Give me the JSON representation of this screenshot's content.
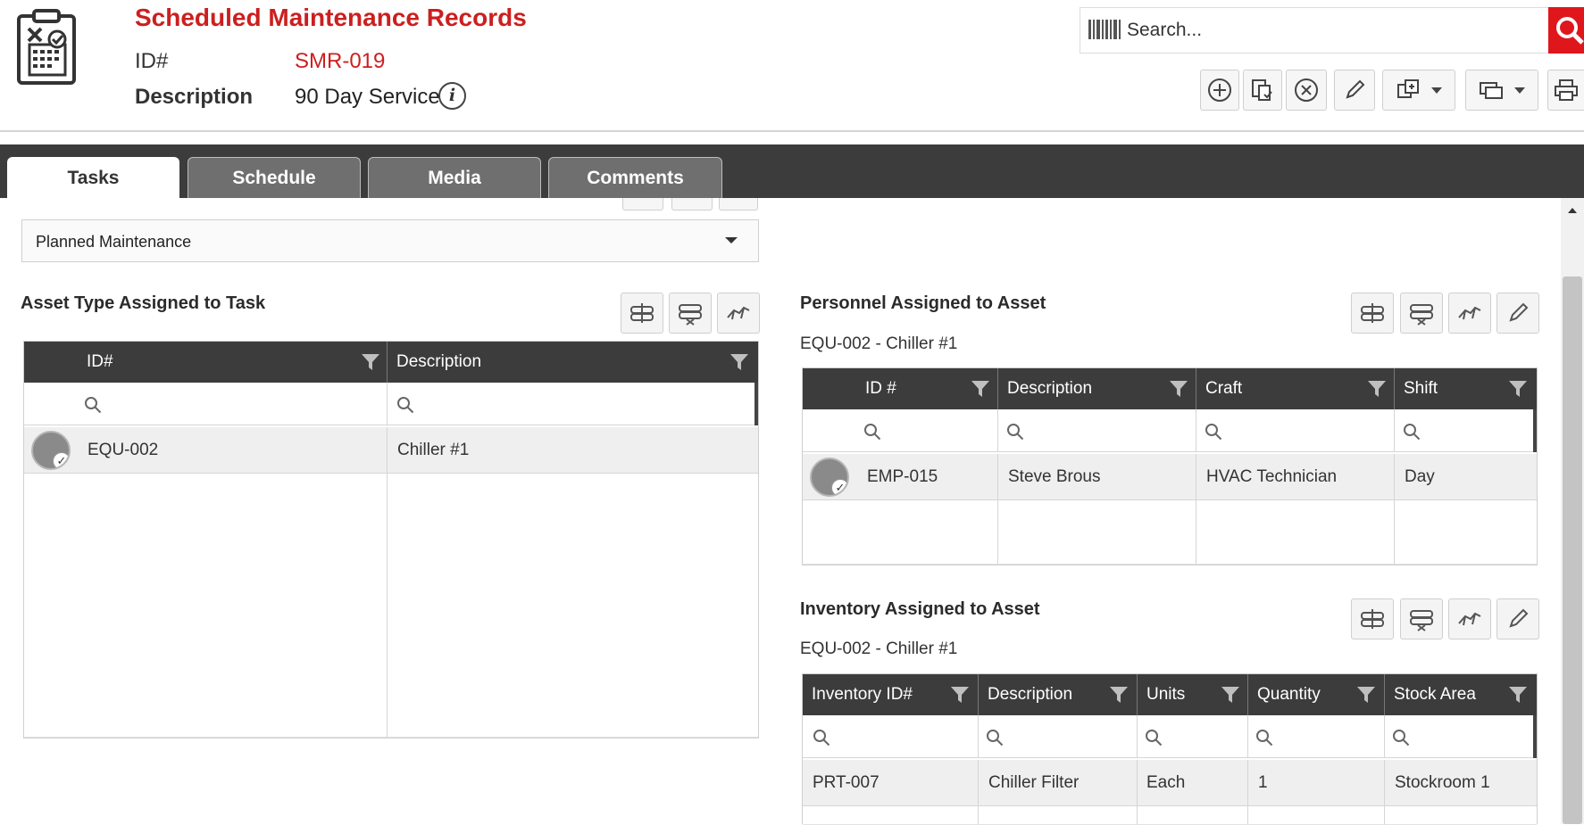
{
  "header": {
    "title": "Scheduled Maintenance Records",
    "id_label": "ID#",
    "id_value": "SMR-019",
    "description_label": "Description",
    "description_value": "90 Day Service",
    "info_glyph": "i"
  },
  "search": {
    "placeholder": "Search..."
  },
  "toolbar": {
    "buttons": [
      "add-icon",
      "copy-icon",
      "cancel-icon",
      "edit-icon",
      "clone-icon",
      "message-icon",
      "print-icon"
    ]
  },
  "tabs": [
    {
      "label": "Tasks",
      "active": true
    },
    {
      "label": "Schedule",
      "active": false
    },
    {
      "label": "Media",
      "active": false
    },
    {
      "label": "Comments",
      "active": false
    }
  ],
  "task_type": {
    "selected": "Planned Maintenance"
  },
  "asset_type": {
    "title": "Asset Type Assigned to Task",
    "columns": [
      "ID#",
      "Description"
    ],
    "rows": [
      {
        "id": "EQU-002",
        "description": "Chiller #1"
      }
    ]
  },
  "personnel": {
    "title": "Personnel Assigned to Asset",
    "subtitle": "EQU-002 - Chiller #1",
    "columns": [
      "ID #",
      "Description",
      "Craft",
      "Shift"
    ],
    "rows": [
      {
        "id": "EMP-015",
        "description": "Steve Brous",
        "craft": "HVAC Technician",
        "shift": "Day"
      }
    ]
  },
  "inventory": {
    "title": "Inventory Assigned to Asset",
    "subtitle": "EQU-002 - Chiller #1",
    "columns": [
      "Inventory ID#",
      "Description",
      "Units",
      "Quantity",
      "Stock Area"
    ],
    "rows": [
      {
        "id": "PRT-007",
        "description": "Chiller Filter",
        "units": "Each",
        "quantity": "1",
        "stock_area": "Stockroom 1"
      }
    ]
  },
  "colors": {
    "accent": "#cc1f1f",
    "search_button": "#e0161d",
    "tab_bar": "#3c3c3c",
    "grid_header": "#3c3c3c"
  }
}
